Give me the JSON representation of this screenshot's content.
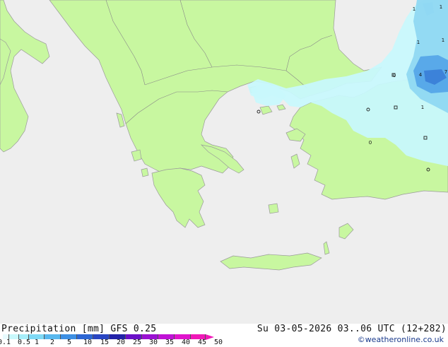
{
  "map": {
    "sea_color": "#eeeeee",
    "land_color": "#c8f7a0",
    "precip_colors": {
      "light": "#c8f8fc",
      "medium": "#8fd8f2",
      "heavy": "#55a6e8",
      "strong": "#3b7fd8"
    },
    "value_labels": [
      "1",
      "1",
      "1",
      "1",
      "4",
      "7",
      "1",
      "0",
      "0"
    ]
  },
  "footer": {
    "title": "Precipitation [mm]  GFS 0.25",
    "valid_time": "Su 03-05-2026 03..06 UTC (12+282)",
    "credit": "©weatheronline.co.uk"
  },
  "legend": {
    "ticks": [
      "0.1",
      "0.5",
      "1",
      "2",
      "5",
      "10",
      "15",
      "20",
      "25",
      "30",
      "35",
      "40",
      "45",
      "50"
    ],
    "colors": [
      "#e8fbfe",
      "#c8f8fc",
      "#a6eefa",
      "#7fd9f5",
      "#58b8ee",
      "#3d8fe3",
      "#2c66d4",
      "#2845c2",
      "#2222a8",
      "#6a10c8",
      "#9a10d2",
      "#c012d6",
      "#e014cc",
      "#f018b8"
    ]
  }
}
